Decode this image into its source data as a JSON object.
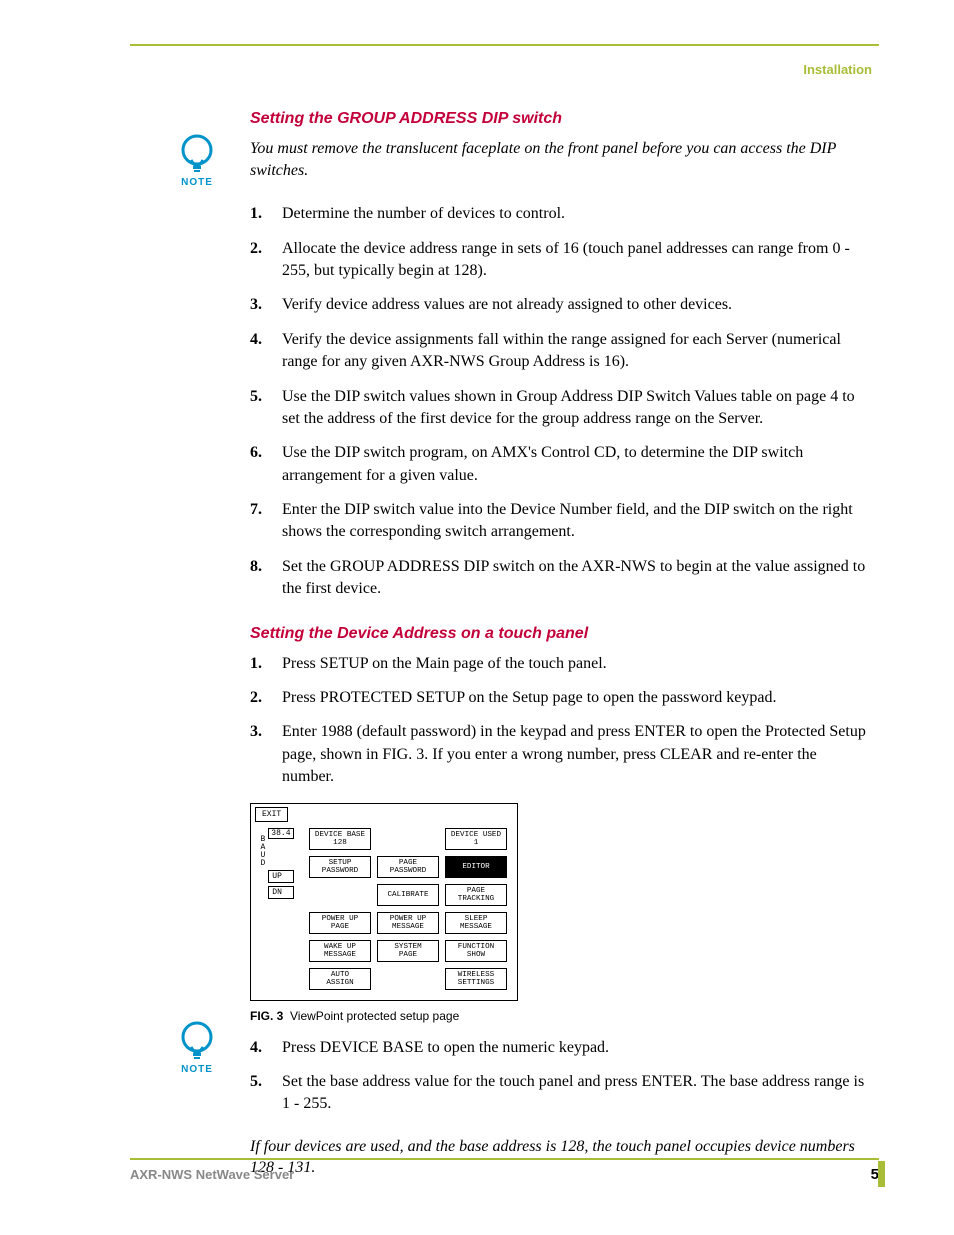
{
  "header": {
    "section": "Installation"
  },
  "note_label": "NOTE",
  "s1": {
    "heading": "Setting the GROUP ADDRESS DIP switch",
    "note": "You must remove the translucent faceplate on the front panel before you can access the DIP switches.",
    "steps": [
      "Determine the number of devices to control.",
      "Allocate the device address range in sets of 16 (touch panel addresses can range from 0 - 255, but typically begin at 128).",
      "Verify device address values are not already assigned to other devices.",
      "Verify the device assignments fall within the range assigned for each Server (numerical range for any given AXR-NWS Group Address is 16).",
      "Use the DIP switch values shown in Group Address DIP Switch Values table on page 4 to set the address of the first device for the group address range on the Server.",
      "Use the DIP switch program, on AMX's Control CD, to determine the DIP switch arrangement for a given value.",
      "Enter the DIP switch value into the Device Number field, and the DIP switch on the right shows the corresponding switch arrangement.",
      "Set the GROUP ADDRESS DIP switch on the AXR-NWS to begin at the value assigned to the first device."
    ]
  },
  "s2": {
    "heading": "Setting the Device Address on a touch panel",
    "steps_a": [
      "Press SETUP on the Main page of the touch panel.",
      "Press PROTECTED SETUP on the Setup page to open the password keypad.",
      "Enter 1988 (default password) in the keypad and press ENTER to open the Protected Setup page, shown in FIG. 3. If you enter a wrong number, press CLEAR and re-enter the number."
    ],
    "steps_b": [
      "Press DEVICE BASE to open the numeric keypad.",
      "Set the base address value for the touch panel and press ENTER. The base address range is 1 - 255."
    ],
    "note2": "If four devices are used, and the base address is 128, the touch panel occupies device numbers 128 - 131."
  },
  "fig": {
    "exit": "EXIT",
    "baud_value": "38.4",
    "baud_letters": [
      "B",
      "A",
      "U",
      "D"
    ],
    "up": "UP",
    "dn": "DN",
    "cells": {
      "r1": [
        "DEVICE BASE\n128",
        "",
        "DEVICE USED\n1"
      ],
      "r2": [
        "SETUP\nPASSWORD",
        "PAGE\nPASSWORD",
        "EDITOR"
      ],
      "r3": [
        "",
        "CALIBRATE",
        "PAGE\nTRACKING"
      ],
      "r4": [
        "POWER UP\nPAGE",
        "POWER UP\nMESSAGE",
        "SLEEP\nMESSAGE"
      ],
      "r5": [
        "WAKE UP\nMESSAGE",
        "SYSTEM\nPAGE",
        "FUNCTION\nSHOW"
      ],
      "r6": [
        "AUTO\nASSIGN",
        "",
        "WIRELESS\nSETTINGS"
      ]
    },
    "caption_label": "FIG. 3",
    "caption_text": "ViewPoint protected setup page"
  },
  "footer": {
    "product": "AXR-NWS NetWave Server",
    "page": "5"
  }
}
